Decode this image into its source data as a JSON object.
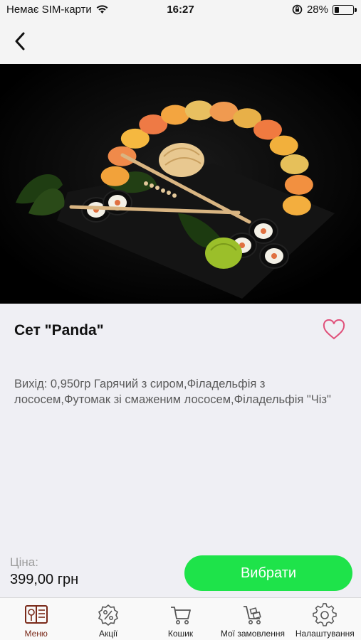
{
  "status_bar": {
    "carrier": "Немає SIM-карти",
    "time": "16:27",
    "battery_percent": "28%",
    "battery_level": 0.28
  },
  "nav": {
    "back_icon": "chevron-left-icon"
  },
  "product": {
    "title": "Сет \"Panda\"",
    "description": "Вихід: 0,950гр  Гарячий з сиром,Філадельфія з лососем,Футомак зі смаженим лососем,Філадельфія \"Чіз\"",
    "price_label": "Ціна:",
    "price": "399,00 грн",
    "select_label": "Вибрати",
    "favorite_icon": "heart-outline-icon"
  },
  "colors": {
    "accent_green": "#1ee34a",
    "favorite_pink": "#e0507a",
    "active_tab": "#7a2a1a"
  },
  "tabs": [
    {
      "label": "Меню",
      "icon": "menu-book-icon",
      "active": true
    },
    {
      "label": "Акції",
      "icon": "discount-icon",
      "active": false
    },
    {
      "label": "Кошик",
      "icon": "cart-icon",
      "active": false
    },
    {
      "label": "Мої замовлення",
      "icon": "orders-cart-icon",
      "active": false
    },
    {
      "label": "Налаштування",
      "icon": "gear-icon",
      "active": false
    }
  ]
}
